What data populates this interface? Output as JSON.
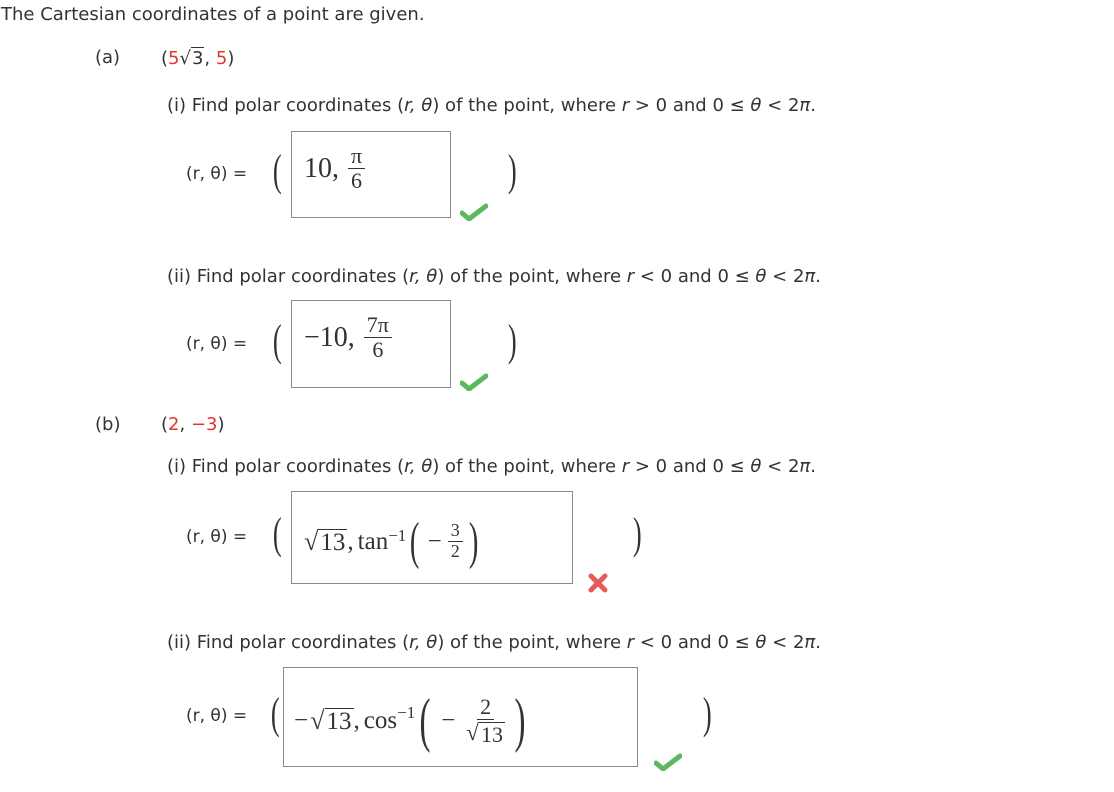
{
  "header": "The Cartesian coordinates of a point are given.",
  "parts": [
    {
      "label": "(a)",
      "point": {
        "open": "(",
        "x_coef": "5",
        "x_sqrt": "3",
        "sep": ",",
        "y": "5",
        "close": ")"
      },
      "subparts": [
        {
          "prompt_prefix": "(i) Find polar coordinates (",
          "prompt_vars": "r, θ",
          "prompt_mid": ") of the point, where ",
          "condition_var": "r",
          "condition": " > 0 and 0 ≤ ",
          "condition_theta": "θ",
          "condition_end": " < 2",
          "condition_pi": "π",
          "condition_dot": ".",
          "lhs": "(r, θ) =",
          "answer": {
            "r": "10,",
            "theta_num": "π",
            "theta_den": "6"
          },
          "status": "correct"
        },
        {
          "prompt_prefix": "(ii) Find polar coordinates (",
          "prompt_vars": "r, θ",
          "prompt_mid": ") of the point, where ",
          "condition_var": "r",
          "condition": " < 0 and 0 ≤ ",
          "condition_theta": "θ",
          "condition_end": " < 2",
          "condition_pi": "π",
          "condition_dot": ".",
          "lhs": "(r, θ) =",
          "answer": {
            "r": "−10,",
            "theta_num": "7π",
            "theta_den": "6"
          },
          "status": "correct"
        }
      ]
    },
    {
      "label": "(b)",
      "point": {
        "open": "(",
        "x": "2",
        "sep": ",",
        "y": "−3",
        "close": ")"
      },
      "subparts": [
        {
          "prompt_prefix": "(i) Find polar coordinates (",
          "prompt_vars": "r, θ",
          "prompt_mid": ") of the point, where ",
          "condition_var": "r",
          "condition": " > 0 and 0 ≤ ",
          "condition_theta": "θ",
          "condition_end": " < 2",
          "condition_pi": "π",
          "condition_dot": ".",
          "lhs": "(r, θ) =",
          "answer": {
            "r_sqrt": "13",
            "sep": ",",
            "func": "tan",
            "exp": "−1",
            "sign": "−",
            "num": "3",
            "den": "2"
          },
          "status": "incorrect"
        },
        {
          "prompt_prefix": "(ii) Find polar coordinates (",
          "prompt_vars": "r, θ",
          "prompt_mid": ") of the point, where ",
          "condition_var": "r",
          "condition": " < 0 and 0 ≤ ",
          "condition_theta": "θ",
          "condition_end": " < 2",
          "condition_pi": "π",
          "condition_dot": ".",
          "lhs": "(r, θ) =",
          "answer": {
            "r_sign": "−",
            "r_sqrt": "13",
            "sep": ",",
            "func": "cos",
            "exp": "−1",
            "sign": "−",
            "num": "2",
            "den_sqrt": "13"
          },
          "status": "correct"
        }
      ]
    }
  ],
  "paren_open": "(",
  "paren_close": ")",
  "colors": {
    "correct": "#5cb85c",
    "incorrect": "#e8595a",
    "highlight": "#e3342f",
    "text": "#333333"
  }
}
